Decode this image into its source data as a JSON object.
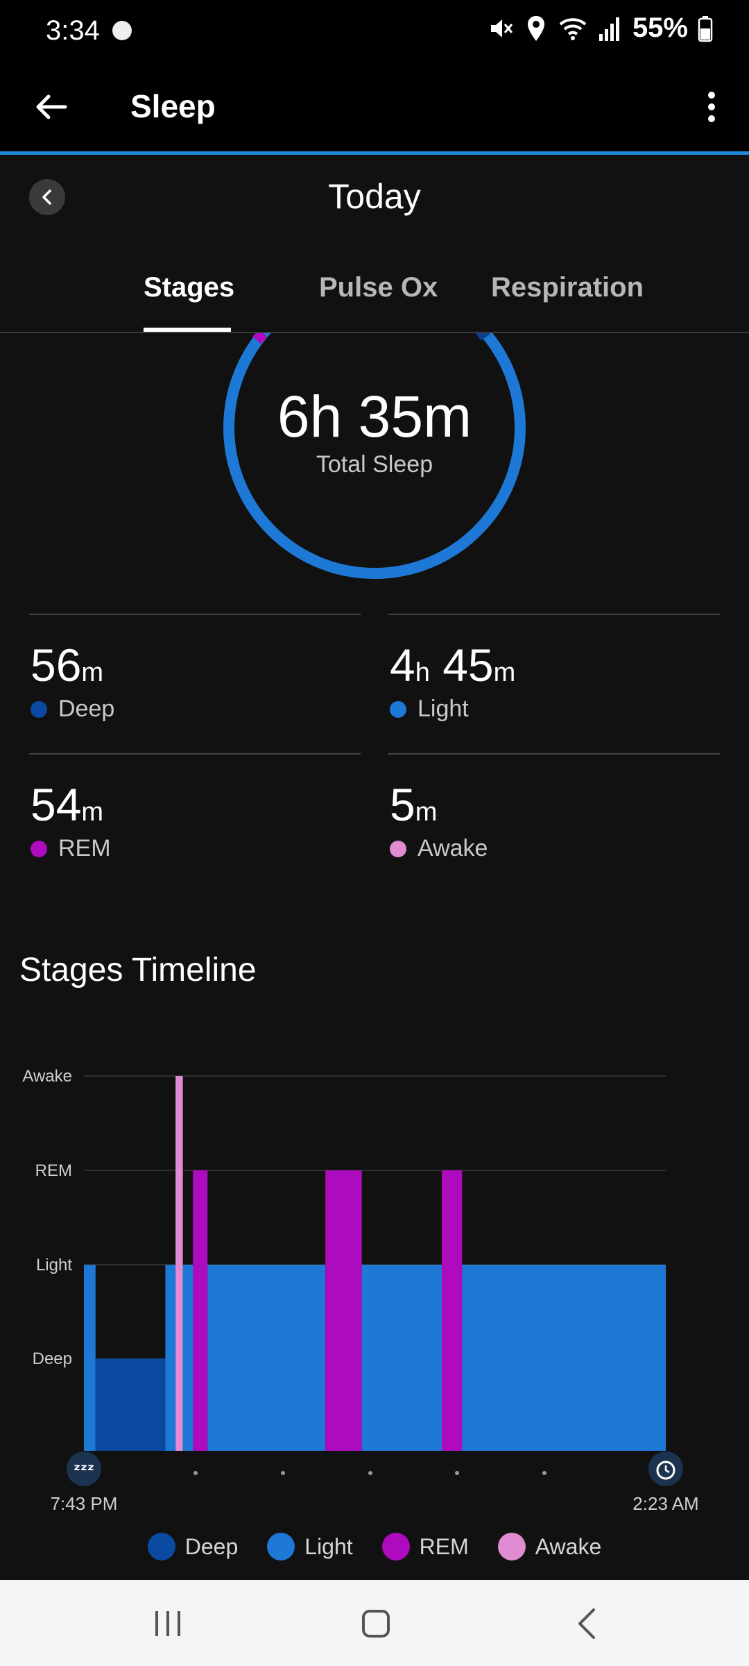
{
  "status": {
    "time": "3:34",
    "battery": "55%"
  },
  "app": {
    "title": "Sleep"
  },
  "date": {
    "title": "Today"
  },
  "tabs": [
    {
      "label": "Stages",
      "active": true
    },
    {
      "label": "Pulse Ox",
      "active": false
    },
    {
      "label": "Respiration",
      "active": false
    }
  ],
  "summary": {
    "total_value": "6h 35m",
    "total_label": "Total Sleep"
  },
  "stats": {
    "deep": {
      "num": "56",
      "unit": "m",
      "label": "Deep"
    },
    "light": {
      "num1": "4",
      "unit1": "h",
      "num2": " 45",
      "unit2": "m",
      "label": "Light"
    },
    "rem": {
      "num": "54",
      "unit": "m",
      "label": "REM"
    },
    "awake": {
      "num": "5",
      "unit": "m",
      "label": "Awake"
    }
  },
  "section_title": "Stages Timeline",
  "colors": {
    "deep": "#0a4aa0",
    "light": "#1e78d6",
    "rem": "#ae0bbf",
    "awake": "#e08bd2",
    "accent": "#1e88d9"
  },
  "chart_data": {
    "type": "bar",
    "start_time": "7:43 PM",
    "end_time": "2:23 AM",
    "stage_levels": [
      "Deep",
      "Light",
      "REM",
      "Awake"
    ],
    "segments": [
      {
        "stage": "Light",
        "start_min": 0,
        "end_min": 8
      },
      {
        "stage": "Deep",
        "start_min": 8,
        "end_min": 56
      },
      {
        "stage": "Light",
        "start_min": 56,
        "end_min": 63
      },
      {
        "stage": "Awake",
        "start_min": 63,
        "end_min": 68
      },
      {
        "stage": "Light",
        "start_min": 68,
        "end_min": 75
      },
      {
        "stage": "REM",
        "start_min": 75,
        "end_min": 85
      },
      {
        "stage": "Light",
        "start_min": 85,
        "end_min": 166
      },
      {
        "stage": "REM",
        "start_min": 166,
        "end_min": 191
      },
      {
        "stage": "Light",
        "start_min": 191,
        "end_min": 246
      },
      {
        "stage": "REM",
        "start_min": 246,
        "end_min": 260
      },
      {
        "stage": "Light",
        "start_min": 260,
        "end_min": 400
      }
    ]
  },
  "legend": [
    {
      "label": "Deep",
      "color": "#0a4aa0"
    },
    {
      "label": "Light",
      "color": "#1e78d6"
    },
    {
      "label": "REM",
      "color": "#ae0bbf"
    },
    {
      "label": "Awake",
      "color": "#e08bd2"
    }
  ]
}
